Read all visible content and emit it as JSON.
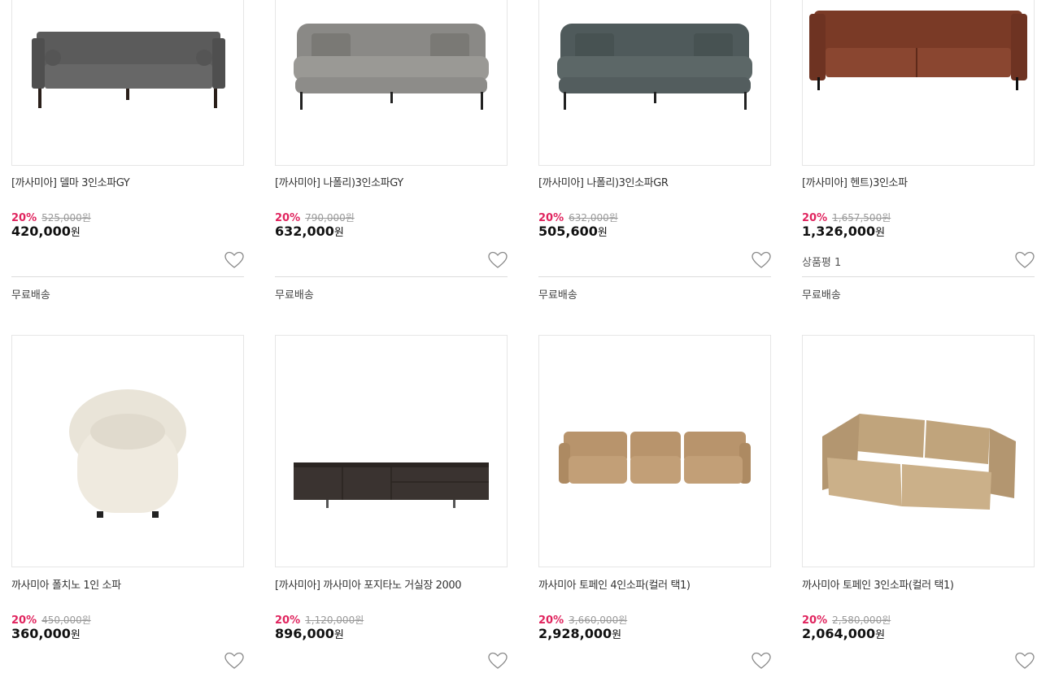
{
  "products": [
    {
      "name": "[까사미아] 델마 3인소파GY",
      "discount": "20%",
      "original_price": "525,000원",
      "price": "420,000",
      "currency": "원",
      "review": "",
      "shipping": "무료배송",
      "image": "gray-tufted-sofa"
    },
    {
      "name": "[까사미아] 나폴리)3인소파GY",
      "discount": "20%",
      "original_price": "790,000원",
      "price": "632,000",
      "currency": "원",
      "review": "",
      "shipping": "무료배송",
      "image": "light-gray-sofa"
    },
    {
      "name": "[까사미아] 나폴리)3인소파GR",
      "discount": "20%",
      "original_price": "632,000원",
      "price": "505,600",
      "currency": "원",
      "review": "",
      "shipping": "무료배송",
      "image": "dark-green-gray-sofa"
    },
    {
      "name": "[까사미아] 헨트)3인소파",
      "discount": "20%",
      "original_price": "1,657,500원",
      "price": "1,326,000",
      "currency": "원",
      "review": "상품평 1",
      "shipping": "무료배송",
      "image": "brown-leather-sofa"
    },
    {
      "name": "까사미아 폴치노 1인 소파",
      "discount": "20%",
      "original_price": "450,000원",
      "price": "360,000",
      "currency": "원",
      "review": "",
      "shipping": "",
      "image": "cream-boucle-chair"
    },
    {
      "name": "[까사미아] 까사미아 포지타노 거실장 2000",
      "discount": "20%",
      "original_price": "1,120,000원",
      "price": "896,000",
      "currency": "원",
      "review": "",
      "shipping": "",
      "image": "dark-tv-cabinet"
    },
    {
      "name": "까사미아 토페인 4인소파(컬러 택1)",
      "discount": "20%",
      "original_price": "3,660,000원",
      "price": "2,928,000",
      "currency": "원",
      "review": "",
      "shipping": "",
      "image": "tan-4-seat-sofa"
    },
    {
      "name": "까사미아 토페인 3인소파(컬러 택1)",
      "discount": "20%",
      "original_price": "2,580,000원",
      "price": "2,064,000",
      "currency": "원",
      "review": "",
      "shipping": "",
      "image": "tan-3-seat-sofa"
    }
  ],
  "colors": {
    "discount": "#e0245e",
    "border": "#e6e6e6",
    "divider": "#dcdcdc"
  }
}
